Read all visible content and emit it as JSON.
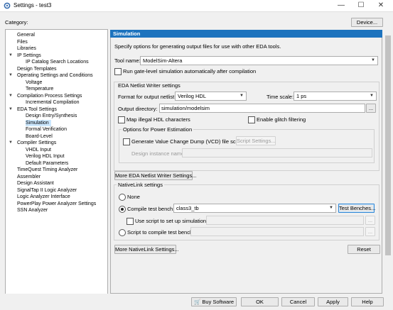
{
  "window": {
    "title": "Settings - test3",
    "minimize": "—",
    "maximize": "☐",
    "close": "✕"
  },
  "category_label": "Category:",
  "device_button": "Device...",
  "tree": [
    {
      "label": "General",
      "level": 0,
      "arrow": ""
    },
    {
      "label": "Files",
      "level": 0,
      "arrow": ""
    },
    {
      "label": "Libraries",
      "level": 0,
      "arrow": ""
    },
    {
      "label": "IP Settings",
      "level": 0,
      "arrow": "▼"
    },
    {
      "label": "IP Catalog Search Locations",
      "level": 1,
      "arrow": ""
    },
    {
      "label": "Design Templates",
      "level": 0,
      "arrow": ""
    },
    {
      "label": "Operating Settings and Conditions",
      "level": 0,
      "arrow": "▼"
    },
    {
      "label": "Voltage",
      "level": 1,
      "arrow": ""
    },
    {
      "label": "Temperature",
      "level": 1,
      "arrow": ""
    },
    {
      "label": "Compilation Process Settings",
      "level": 0,
      "arrow": "▼"
    },
    {
      "label": "Incremental Compilation",
      "level": 1,
      "arrow": ""
    },
    {
      "label": "EDA Tool Settings",
      "level": 0,
      "arrow": "▼"
    },
    {
      "label": "Design Entry/Synthesis",
      "level": 1,
      "arrow": ""
    },
    {
      "label": "Simulation",
      "level": 1,
      "arrow": "",
      "selected": true
    },
    {
      "label": "Formal Verification",
      "level": 1,
      "arrow": ""
    },
    {
      "label": "Board-Level",
      "level": 1,
      "arrow": ""
    },
    {
      "label": "Compiler Settings",
      "level": 0,
      "arrow": "▼"
    },
    {
      "label": "VHDL Input",
      "level": 1,
      "arrow": ""
    },
    {
      "label": "Verilog HDL Input",
      "level": 1,
      "arrow": ""
    },
    {
      "label": "Default Parameters",
      "level": 1,
      "arrow": ""
    },
    {
      "label": "TimeQuest Timing Analyzer",
      "level": 0,
      "arrow": ""
    },
    {
      "label": "Assembler",
      "level": 0,
      "arrow": ""
    },
    {
      "label": "Design Assistant",
      "level": 0,
      "arrow": ""
    },
    {
      "label": "SignalTap II Logic Analyzer",
      "level": 0,
      "arrow": ""
    },
    {
      "label": "Logic Analyzer Interface",
      "level": 0,
      "arrow": ""
    },
    {
      "label": "PowerPlay Power Analyzer Settings",
      "level": 0,
      "arrow": ""
    },
    {
      "label": "SSN Analyzer",
      "level": 0,
      "arrow": ""
    }
  ],
  "panel": {
    "header": "Simulation",
    "description": "Specify options for generating output files for use with other EDA tools.",
    "tool_name_label": "Tool name:",
    "tool_name_value": "ModelSim-Altera",
    "run_gate_level": "Run gate-level simulation automatically after compilation",
    "netlist_group_title": "EDA Netlist Writer settings",
    "format_label": "Format for output netlist:",
    "format_value": "Verilog HDL",
    "time_scale_label": "Time scale:",
    "time_scale_value": "1 ps",
    "output_dir_label": "Output directory:",
    "output_dir_value": "simulation/modelsim",
    "browse_dots": "...",
    "map_illegal": "Map illegal HDL characters",
    "enable_glitch": "Enable glitch filtering",
    "power_group_title": "Options for Power Estimation",
    "vcd_label": "Generate Value Change Dump (VCD) file script",
    "script_settings": "Script Settings...",
    "design_instance_label": "Design instance name:",
    "more_eda_button": "More EDA Netlist Writer Settings...",
    "nativelink_title": "NativeLink settings",
    "none_label": "None",
    "compile_tb_label": "Compile test bench:",
    "compile_tb_value": "class3_tb",
    "test_benches_button": "Test Benches...",
    "use_script_label": "Use script to set up simulation:",
    "script_compile_label": "Script to compile test bench:",
    "more_nativelink_button": "More NativeLink Settings...",
    "reset_button": "Reset"
  },
  "footer": {
    "buy_software": "Buy Software",
    "ok": "OK",
    "cancel": "Cancel",
    "apply": "Apply",
    "help": "Help"
  }
}
